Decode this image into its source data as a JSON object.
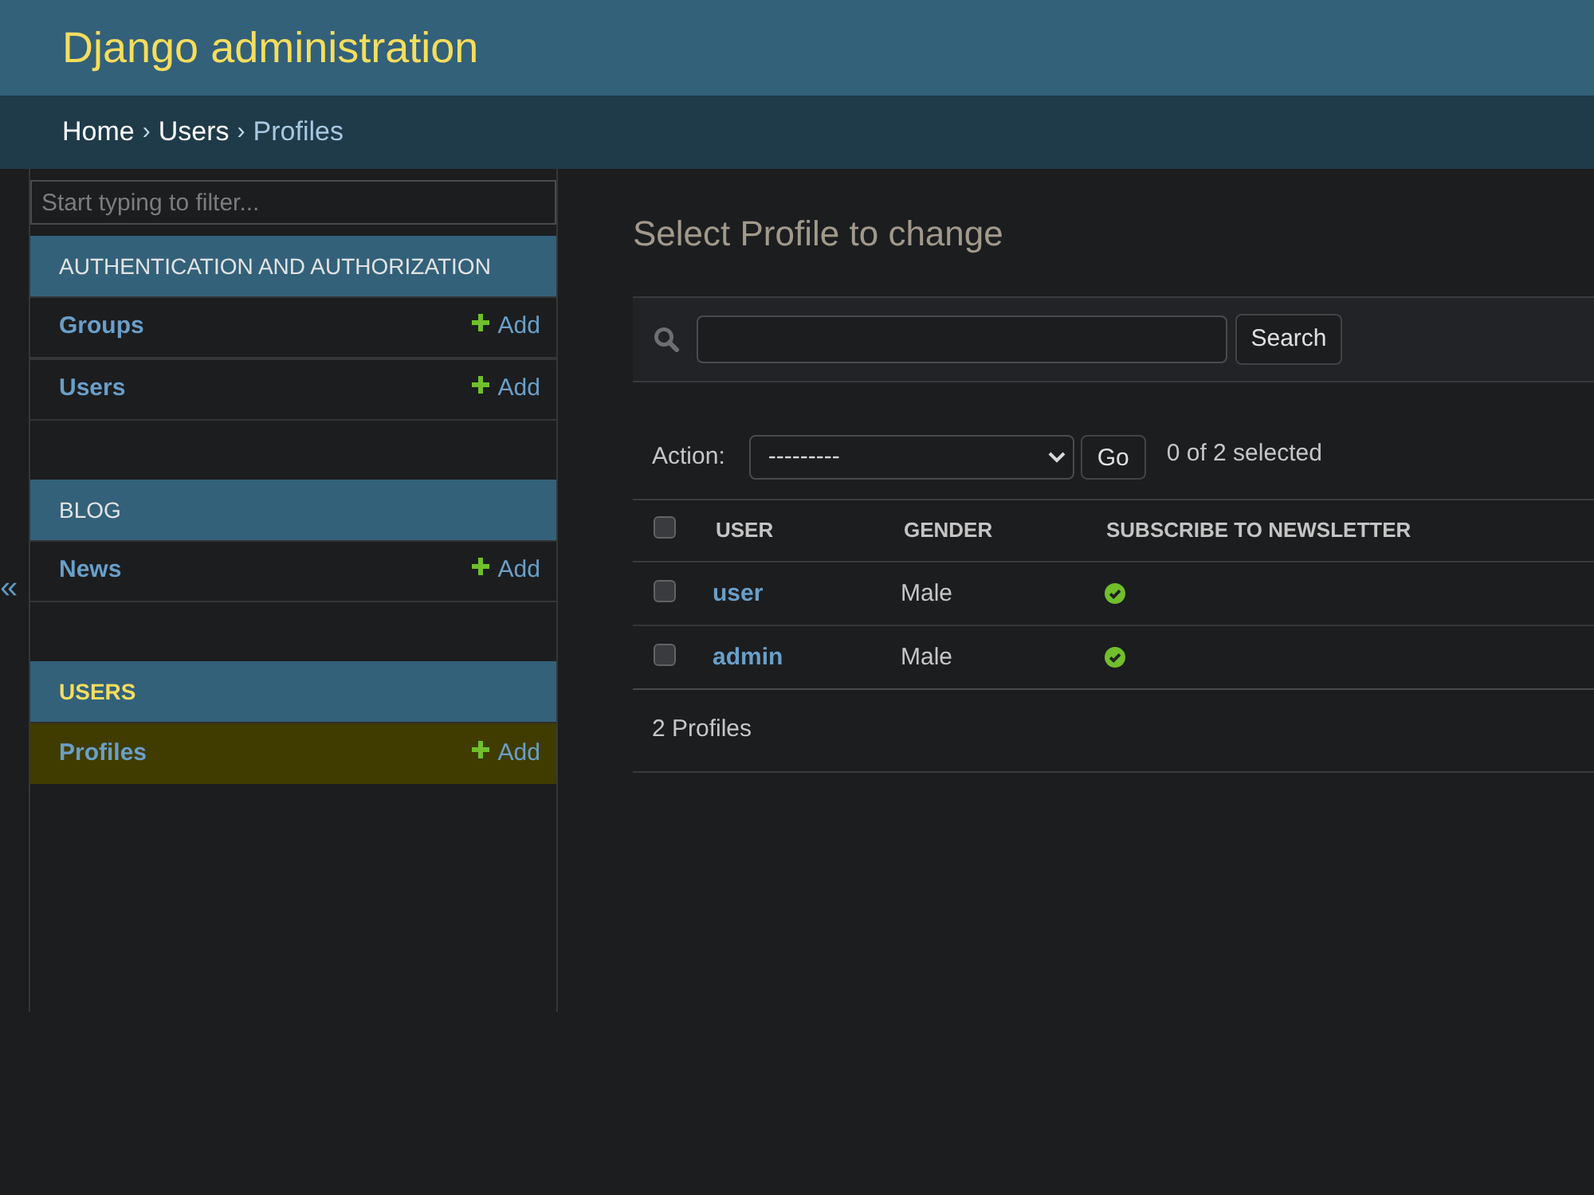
{
  "header": {
    "title": "Django administration"
  },
  "breadcrumbs": [
    {
      "kind": "link",
      "label": "Home"
    },
    {
      "kind": "separator",
      "label": "›"
    },
    {
      "kind": "link",
      "label": "Users"
    },
    {
      "kind": "separator",
      "label": "›"
    },
    {
      "kind": "current",
      "label": "Profiles"
    }
  ],
  "sidebar": {
    "toggle": "«",
    "filter": {
      "placeholder": "Start typing to filter..."
    },
    "modules": [
      {
        "title": "AUTHENTICATION AND AUTHORIZATION",
        "current": false,
        "models": [
          {
            "name": "Groups",
            "add": "Add",
            "selected": false
          },
          {
            "name": "Users",
            "add": "Add",
            "selected": false
          }
        ]
      },
      {
        "title": "BLOG",
        "current": false,
        "models": [
          {
            "name": "News",
            "add": "Add",
            "selected": false
          }
        ]
      },
      {
        "title": "USERS",
        "current": true,
        "models": [
          {
            "name": "Profiles",
            "add": "Add",
            "selected": true
          }
        ]
      }
    ]
  },
  "main": {
    "title": "Select Profile to change",
    "search": {
      "button": "Search"
    },
    "actions": {
      "label": "Action:",
      "select": {
        "value": "---------"
      },
      "button": "Go",
      "counter": "0 of 2 selected"
    },
    "table": {
      "select_all": {
        "checked": false
      },
      "columns": [
        "USER",
        "GENDER",
        "SUBSCRIBE TO NEWSLETTER"
      ],
      "rows": [
        {
          "selected": false,
          "user": "user",
          "gender": "Male",
          "subscribe_to_newsletter": true
        },
        {
          "selected": false,
          "user": "admin",
          "gender": "Male",
          "subscribe_to_newsletter": true
        }
      ]
    },
    "footer": "2 Profiles"
  }
}
